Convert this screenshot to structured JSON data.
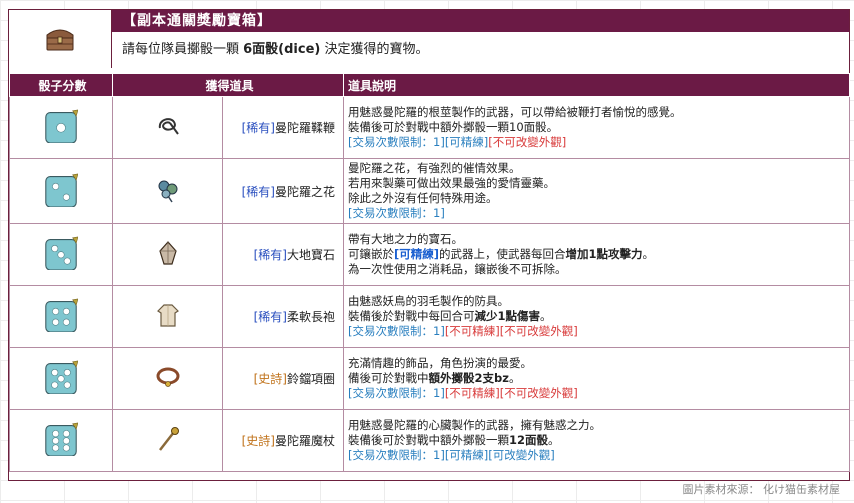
{
  "header": {
    "title": "【副本通關獎勵寶箱】",
    "desc_before": "請每位隊員擲骰一顆 ",
    "desc_bold": "6面骰(dice)",
    "desc_after": " 決定獲得的寶物。",
    "icon": "treasure-chest-icon"
  },
  "columns": [
    "骰子分數",
    "獲得道具",
    "道具說明"
  ],
  "rows": [
    {
      "dice": 1,
      "item_icon": "whip-icon",
      "tier": "[稀有]",
      "tier_class": "rare",
      "name": "曼陀羅鞣鞭",
      "lines": [
        [
          {
            "t": "用魅惑曼陀羅的根莖製作的武器，可以帶給被鞭打者愉悅的感覺。",
            "c": ""
          }
        ],
        [
          {
            "t": "裝備後可於對戰中額外擲骰一顆10面骰。",
            "c": ""
          }
        ],
        [
          {
            "t": "[交易次數限制：1]",
            "c": "trade"
          },
          {
            "t": "[可精練]",
            "c": "refine"
          },
          {
            "t": "[不可改變外觀]",
            "c": "norefine"
          }
        ]
      ]
    },
    {
      "dice": 2,
      "item_icon": "flower-icon",
      "tier": "[稀有]",
      "tier_class": "rare",
      "name": "曼陀羅之花",
      "lines": [
        [
          {
            "t": "曼陀羅之花，有強烈的催情效果。",
            "c": ""
          }
        ],
        [
          {
            "t": "若用來製藥可做出效果最強的愛情靈藥。",
            "c": ""
          }
        ],
        [
          {
            "t": "除此之外沒有任何特殊用途。",
            "c": ""
          }
        ],
        [
          {
            "t": "[交易次數限制：1]",
            "c": "trade"
          }
        ]
      ]
    },
    {
      "dice": 3,
      "item_icon": "gem-icon",
      "tier": "[稀有]",
      "tier_class": "rare",
      "name": "大地寶石",
      "lines": [
        [
          {
            "t": "帶有大地之力的寶石。",
            "c": ""
          }
        ],
        [
          {
            "t": "可鑲嵌於",
            "c": ""
          },
          {
            "t": "[可精練]",
            "c": "hl"
          },
          {
            "t": "的武器上，使武器每回合",
            "c": ""
          },
          {
            "t": "增加1點攻擊力",
            "c": "strong"
          },
          {
            "t": "。",
            "c": ""
          }
        ],
        [
          {
            "t": "為一次性使用之消耗品，鑲嵌後不可拆除。",
            "c": ""
          }
        ]
      ]
    },
    {
      "dice": 4,
      "item_icon": "robe-icon",
      "tier": "[稀有]",
      "tier_class": "rare",
      "name": "柔軟長袍",
      "lines": [
        [
          {
            "t": "由魅惑妖鳥的羽毛製作的防具。",
            "c": ""
          }
        ],
        [
          {
            "t": "裝備後於對戰中每回合可",
            "c": ""
          },
          {
            "t": "減少1點傷害",
            "c": "strong"
          },
          {
            "t": "。",
            "c": ""
          }
        ],
        [
          {
            "t": "[交易次數限制：1]",
            "c": "trade"
          },
          {
            "t": "[不可精練]",
            "c": "norefine"
          },
          {
            "t": "[不可改變外觀]",
            "c": "norefine"
          }
        ]
      ]
    },
    {
      "dice": 5,
      "item_icon": "collar-icon",
      "tier": "[史詩]",
      "tier_class": "epic",
      "name": "鈴鐺項圈",
      "lines": [
        [
          {
            "t": "充滿情趣的飾品，角色扮演的最愛。",
            "c": ""
          }
        ],
        [
          {
            "t": "備後可於對戰中",
            "c": ""
          },
          {
            "t": "額外擲骰2支bz",
            "c": "strong"
          },
          {
            "t": "。",
            "c": ""
          }
        ],
        [
          {
            "t": "[交易次數限制：1]",
            "c": "trade"
          },
          {
            "t": "[不可精練]",
            "c": "norefine"
          },
          {
            "t": "[不可改變外觀]",
            "c": "norefine"
          }
        ]
      ]
    },
    {
      "dice": 6,
      "item_icon": "staff-icon",
      "tier": "[史詩]",
      "tier_class": "epic",
      "name": "曼陀羅魔杖",
      "lines": [
        [
          {
            "t": "用魅惑曼陀羅的心臟製作的武器，擁有魅惑之力。",
            "c": ""
          }
        ],
        [
          {
            "t": "裝備後可於對戰中額外擲骰一顆",
            "c": ""
          },
          {
            "t": "12面骰",
            "c": "strong"
          },
          {
            "t": "。",
            "c": ""
          }
        ],
        [
          {
            "t": "[交易次數限制：1]",
            "c": "trade"
          },
          {
            "t": "[可精練]",
            "c": "refine"
          },
          {
            "t": "[可改變外觀]",
            "c": "refine"
          }
        ]
      ]
    }
  ],
  "credit": "圖片素材來源： 化け猫缶素材屋",
  "colors": {
    "header_bg": "#6b1a45",
    "dice_face": "#7ec6cf",
    "pip": "#ffffff"
  }
}
